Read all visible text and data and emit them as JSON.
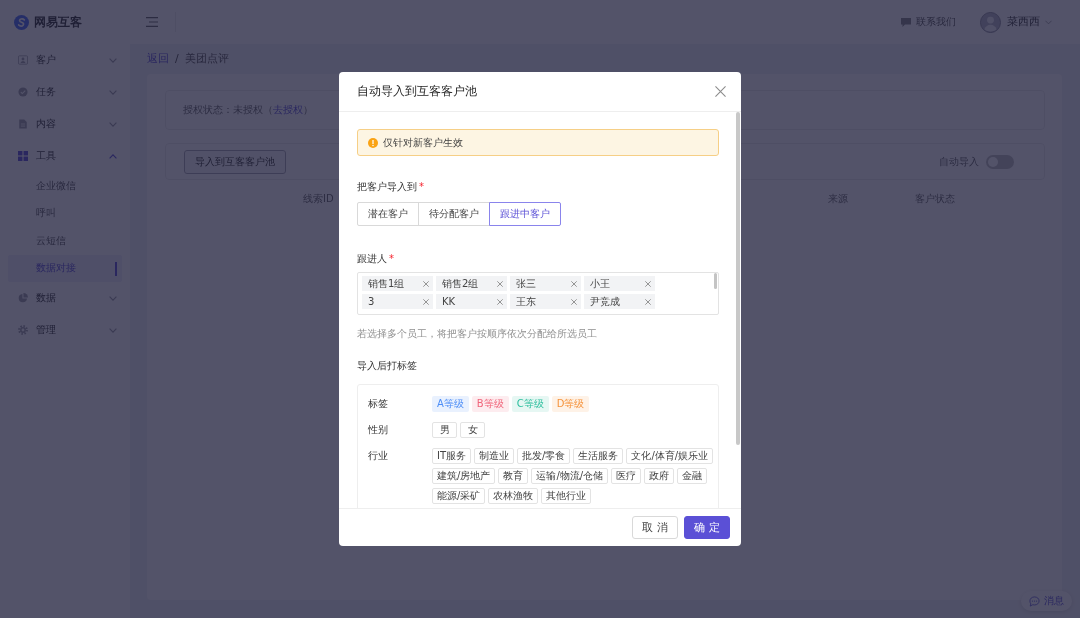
{
  "sidebar": {
    "logo": "网易互客",
    "items": [
      {
        "label": "客户",
        "expanded": false
      },
      {
        "label": "任务",
        "expanded": false
      },
      {
        "label": "内容",
        "expanded": false
      },
      {
        "label": "工具",
        "expanded": true,
        "children": [
          {
            "label": "企业微信",
            "selected": false
          },
          {
            "label": "呼叫",
            "selected": false
          },
          {
            "label": "云短信",
            "selected": false
          },
          {
            "label": "数据对接",
            "selected": true
          }
        ]
      },
      {
        "label": "数据",
        "expanded": false
      },
      {
        "label": "管理",
        "expanded": false
      }
    ]
  },
  "header": {
    "contact": "联系我们",
    "user": "菜西西"
  },
  "breadcrumb": {
    "back": "返回",
    "separator": "/",
    "current": "美团点评"
  },
  "auth_status": {
    "text": "授权状态：未授权（",
    "link": "去授权",
    "closing": "）"
  },
  "toolbar": {
    "import_button": "导入到互客客户池",
    "auto_import": {
      "label": "自动导入",
      "on": false
    }
  },
  "table": {
    "columns": [
      "线索ID",
      "来源",
      "客户状态"
    ]
  },
  "message_button": "消息",
  "dialog": {
    "title": "自动导入到互客客户池",
    "notice": "仅针对新客户生效",
    "pool": {
      "label": "把客户导入到",
      "required_mark": "*",
      "options": [
        {
          "label": "潜在客户",
          "selected": false
        },
        {
          "label": "待分配客户",
          "selected": false
        },
        {
          "label": "跟进中客户",
          "selected": true
        }
      ]
    },
    "followers": {
      "label": "跟进人",
      "required_mark": "*",
      "tags": [
        "销售1组",
        "销售2组",
        "张三",
        "小王",
        "3",
        "KK",
        "王东",
        "尹竞成"
      ]
    },
    "hint": "若选择多个员工，将把客户按顺序依次分配给所选员工",
    "tagging": {
      "label": "导入后打标签",
      "groups": [
        {
          "label": "标签",
          "tags": [
            {
              "label": "A等级",
              "color": "#4c8df6"
            },
            {
              "label": "B等级",
              "color": "#f0647a"
            },
            {
              "label": "C等级",
              "color": "#2ebf9e"
            },
            {
              "label": "D等级",
              "color": "#f5923a"
            }
          ]
        },
        {
          "label": "性别",
          "tags": [
            {
              "label": "男"
            },
            {
              "label": "女"
            }
          ]
        },
        {
          "label": "行业",
          "tags": [
            {
              "label": "IT服务"
            },
            {
              "label": "制造业"
            },
            {
              "label": "批发/零食"
            },
            {
              "label": "生活服务"
            },
            {
              "label": "文化/体育/娱乐业"
            },
            {
              "label": "建筑/房地产"
            },
            {
              "label": "教育"
            },
            {
              "label": "运输/物流/仓储"
            },
            {
              "label": "医疗"
            },
            {
              "label": "政府"
            },
            {
              "label": "金融"
            },
            {
              "label": "能源/采矿"
            },
            {
              "label": "农林渔牧"
            },
            {
              "label": "其他行业"
            }
          ]
        }
      ]
    },
    "buttons": [
      {
        "label": "取 消",
        "kind": "default"
      },
      {
        "label": "确 定",
        "kind": "primary"
      }
    ]
  }
}
